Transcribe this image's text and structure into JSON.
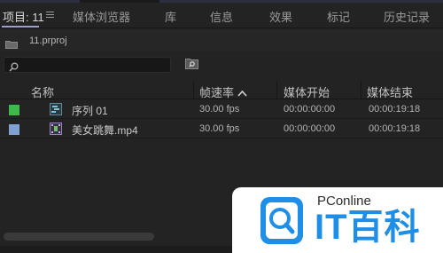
{
  "tabs": [
    {
      "label": "项目: 11",
      "active": true
    },
    {
      "label": "媒体浏览器",
      "active": false
    },
    {
      "label": "库",
      "active": false
    },
    {
      "label": "信息",
      "active": false
    },
    {
      "label": "效果",
      "active": false
    },
    {
      "label": "标记",
      "active": false
    },
    {
      "label": "历史记录",
      "active": false
    }
  ],
  "project": {
    "file_name": "11.prproj"
  },
  "search": {
    "value": "",
    "placeholder": ""
  },
  "columns": {
    "name": "名称",
    "frame_rate": "帧速率",
    "media_start": "媒体开始",
    "media_end": "媒体结束"
  },
  "rows": [
    {
      "label_color": "#3fb84a",
      "icon": "sequence-icon",
      "name": "序列 01",
      "frame_rate": "30.00 fps",
      "media_start": "00:00:00:00",
      "media_end": "00:00:19:18"
    },
    {
      "label_color": "#7fa1d4",
      "icon": "video-clip-icon",
      "name": "美女跳舞.mp4",
      "frame_rate": "30.00 fps",
      "media_start": "00:00:00:00",
      "media_end": "00:00:19:18"
    }
  ],
  "watermark": {
    "brand": "PConline",
    "title": "IT百科",
    "accent_color": "#1f8ee6"
  }
}
